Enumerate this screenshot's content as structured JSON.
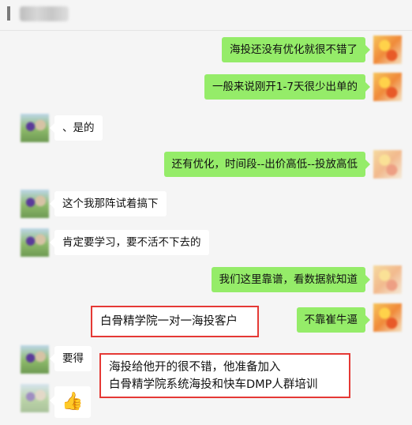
{
  "window": {
    "title_blurred": true
  },
  "messages": [
    {
      "side": "out",
      "text": "海投还没有优化就很不错了"
    },
    {
      "side": "out",
      "text": "一般来说刚开1-7天很少出单的"
    },
    {
      "side": "in",
      "text": "、是的"
    },
    {
      "side": "out",
      "text": "还有优化，时间段--出价高低--投放高低"
    },
    {
      "side": "in",
      "text": "这个我那阵试着搞下"
    },
    {
      "side": "in",
      "text": "肯定要学习，要不活不下去的"
    },
    {
      "side": "out",
      "text": "我们这里靠谱，看数据就知道"
    },
    {
      "side": "out",
      "text": "不靠崔牛逼"
    },
    {
      "side": "in",
      "text": "要得"
    },
    {
      "side": "in",
      "emoji": "thumbs-up-icon"
    }
  ],
  "annotations": {
    "box1": {
      "text": "白骨精学院一对一海投客户"
    },
    "box2": {
      "line1": "海投给他开的很不错，他准备加入",
      "line2": "白骨精学院系统海投和快车DMP人群培训"
    }
  },
  "colors": {
    "outgoing_bubble": "#95ec69",
    "incoming_bubble": "#ffffff",
    "annotation_border": "#e53935",
    "background": "#f5f5f5"
  }
}
